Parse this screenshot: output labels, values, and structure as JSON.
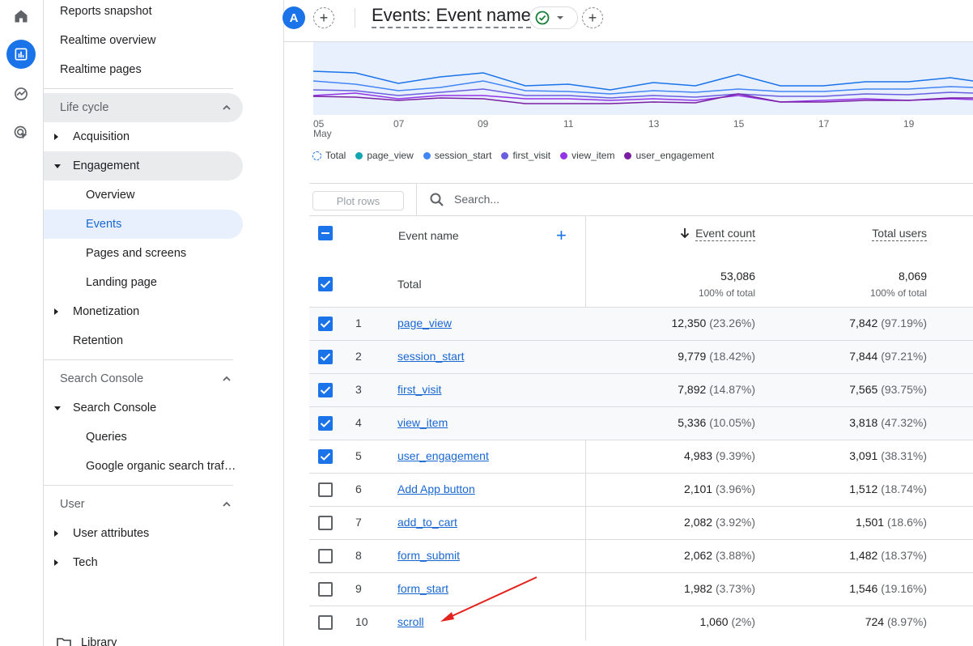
{
  "header": {
    "avatar_letter": "A",
    "title": "Events: Event name"
  },
  "sidebar": {
    "top_items": [
      "Reports snapshot",
      "Realtime overview",
      "Realtime pages"
    ],
    "life_cycle": "Life cycle",
    "acquisition": "Acquisition",
    "engagement": "Engagement",
    "engagement_items": [
      "Overview",
      "Events",
      "Pages and screens",
      "Landing page"
    ],
    "monetization": "Monetization",
    "retention": "Retention",
    "search_console_section": "Search Console",
    "search_console": "Search Console",
    "search_console_items": [
      "Queries",
      "Google organic search traf…"
    ],
    "user_section": "User",
    "user_attributes": "User attributes",
    "tech": "Tech",
    "library": "Library"
  },
  "chart": {
    "x_ticks": [
      "05",
      "07",
      "09",
      "11",
      "13",
      "15",
      "17",
      "19"
    ],
    "month_label": "May",
    "legend": [
      {
        "name": "Total",
        "color": "#1a73e8"
      },
      {
        "name": "page_view",
        "color": "#12a4af"
      },
      {
        "name": "session_start",
        "color": "#4285f4"
      },
      {
        "name": "first_visit",
        "color": "#6a5ee0"
      },
      {
        "name": "view_item",
        "color": "#9334e6"
      },
      {
        "name": "user_engagement",
        "color": "#7b1fa2"
      }
    ]
  },
  "toolbar": {
    "plot_rows": "Plot rows",
    "search_placeholder": "Search..."
  },
  "table": {
    "col_event_name": "Event name",
    "col_event_count": "Event count",
    "col_total_users": "Total users",
    "total_label": "Total",
    "total_event_count": "53,086",
    "total_event_count_sub": "100% of total",
    "total_users": "8,069",
    "total_users_sub": "100% of total",
    "rows": [
      {
        "num": "1",
        "name": "page_view",
        "count": "12,350",
        "count_pct": "(23.26%)",
        "users": "7,842",
        "users_pct": "(97.19%)",
        "checked": true
      },
      {
        "num": "2",
        "name": "session_start",
        "count": "9,779",
        "count_pct": "(18.42%)",
        "users": "7,844",
        "users_pct": "(97.21%)",
        "checked": true
      },
      {
        "num": "3",
        "name": "first_visit",
        "count": "7,892",
        "count_pct": "(14.87%)",
        "users": "7,565",
        "users_pct": "(93.75%)",
        "checked": true
      },
      {
        "num": "4",
        "name": "view_item",
        "count": "5,336",
        "count_pct": "(10.05%)",
        "users": "3,818",
        "users_pct": "(47.32%)",
        "checked": true
      },
      {
        "num": "5",
        "name": "user_engagement",
        "count": "4,983",
        "count_pct": "(9.39%)",
        "users": "3,091",
        "users_pct": "(38.31%)",
        "checked": true
      },
      {
        "num": "6",
        "name": "Add App button",
        "count": "2,101",
        "count_pct": "(3.96%)",
        "users": "1,512",
        "users_pct": "(18.74%)",
        "checked": false
      },
      {
        "num": "7",
        "name": "add_to_cart",
        "count": "2,082",
        "count_pct": "(3.92%)",
        "users": "1,501",
        "users_pct": "(18.6%)",
        "checked": false
      },
      {
        "num": "8",
        "name": "form_submit",
        "count": "2,062",
        "count_pct": "(3.88%)",
        "users": "1,482",
        "users_pct": "(18.37%)",
        "checked": false
      },
      {
        "num": "9",
        "name": "form_start",
        "count": "1,982",
        "count_pct": "(3.73%)",
        "users": "1,546",
        "users_pct": "(19.16%)",
        "checked": false
      },
      {
        "num": "10",
        "name": "scroll",
        "count": "1,060",
        "count_pct": "(2%)",
        "users": "724",
        "users_pct": "(8.97%)",
        "checked": false
      }
    ]
  }
}
